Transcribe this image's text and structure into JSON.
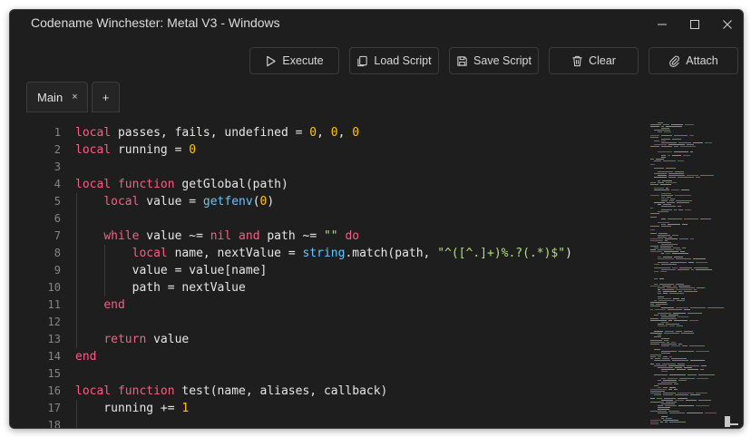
{
  "window": {
    "title": "Codename Winchester: Metal V3 - Windows",
    "controls": {
      "minimize": "—",
      "maximize": "☐",
      "close": "✕"
    }
  },
  "toolbar": {
    "buttons": [
      {
        "id": "execute",
        "label": "Execute",
        "icon": "play-icon"
      },
      {
        "id": "load",
        "label": "Load Script",
        "icon": "file-copy-icon"
      },
      {
        "id": "save",
        "label": "Save Script",
        "icon": "save-icon"
      },
      {
        "id": "clear",
        "label": "Clear",
        "icon": "trash-icon"
      },
      {
        "id": "attach",
        "label": "Attach",
        "icon": "paperclip-icon"
      }
    ]
  },
  "tabs": {
    "items": [
      {
        "label": "Main",
        "close": "×"
      }
    ],
    "add_label": "+"
  },
  "colors": {
    "keyword": "#f75f84",
    "number": "#ffc600",
    "builtin": "#61c8ff",
    "string": "#ade26b",
    "text": "#e6e6e6",
    "line_number": "#858585",
    "background": "#1e1e1e"
  },
  "editor": {
    "lines": [
      {
        "num": "1",
        "tokens": [
          [
            "k",
            "local"
          ],
          [
            "p",
            " passes, fails, undefined = "
          ],
          [
            "n",
            "0"
          ],
          [
            "p",
            ", "
          ],
          [
            "n",
            "0"
          ],
          [
            "p",
            ", "
          ],
          [
            "n",
            "0"
          ]
        ]
      },
      {
        "num": "2",
        "tokens": [
          [
            "k",
            "local"
          ],
          [
            "p",
            " running = "
          ],
          [
            "n",
            "0"
          ]
        ]
      },
      {
        "num": "3",
        "tokens": []
      },
      {
        "num": "4",
        "tokens": [
          [
            "k",
            "local function"
          ],
          [
            "p",
            " getGlobal(path)"
          ]
        ]
      },
      {
        "num": "5",
        "tokens": [
          [
            "p",
            "    "
          ],
          [
            "k",
            "local"
          ],
          [
            "p",
            " value = "
          ],
          [
            "f",
            "getfenv"
          ],
          [
            "p",
            "("
          ],
          [
            "n",
            "0"
          ],
          [
            "p",
            ")"
          ]
        ]
      },
      {
        "num": "6",
        "tokens": []
      },
      {
        "num": "7",
        "tokens": [
          [
            "p",
            "    "
          ],
          [
            "k",
            "while"
          ],
          [
            "p",
            " value ~= "
          ],
          [
            "k",
            "nil and"
          ],
          [
            "p",
            " path ~= "
          ],
          [
            "s",
            "\"\""
          ],
          [
            "p",
            " "
          ],
          [
            "k",
            "do"
          ]
        ]
      },
      {
        "num": "8",
        "tokens": [
          [
            "p",
            "        "
          ],
          [
            "k",
            "local"
          ],
          [
            "p",
            " name, nextValue = "
          ],
          [
            "f",
            "string"
          ],
          [
            "p",
            ".match(path, "
          ],
          [
            "s",
            "\"^([^.]+)%.?(.*)$\""
          ],
          [
            "p",
            ")"
          ]
        ]
      },
      {
        "num": "9",
        "tokens": [
          [
            "p",
            "        value = value[name]"
          ]
        ]
      },
      {
        "num": "10",
        "tokens": [
          [
            "p",
            "        path = nextValue"
          ]
        ]
      },
      {
        "num": "11",
        "tokens": [
          [
            "p",
            "    "
          ],
          [
            "k",
            "end"
          ]
        ]
      },
      {
        "num": "12",
        "tokens": []
      },
      {
        "num": "13",
        "tokens": [
          [
            "p",
            "    "
          ],
          [
            "k",
            "return"
          ],
          [
            "p",
            " value"
          ]
        ]
      },
      {
        "num": "14",
        "tokens": [
          [
            "k",
            "end"
          ]
        ]
      },
      {
        "num": "15",
        "tokens": []
      },
      {
        "num": "16",
        "tokens": [
          [
            "k",
            "local function"
          ],
          [
            "p",
            " test(name, aliases, callback)"
          ]
        ]
      },
      {
        "num": "17",
        "tokens": [
          [
            "p",
            "    running += "
          ],
          [
            "n",
            "1"
          ]
        ]
      },
      {
        "num": "18",
        "tokens": []
      }
    ]
  }
}
